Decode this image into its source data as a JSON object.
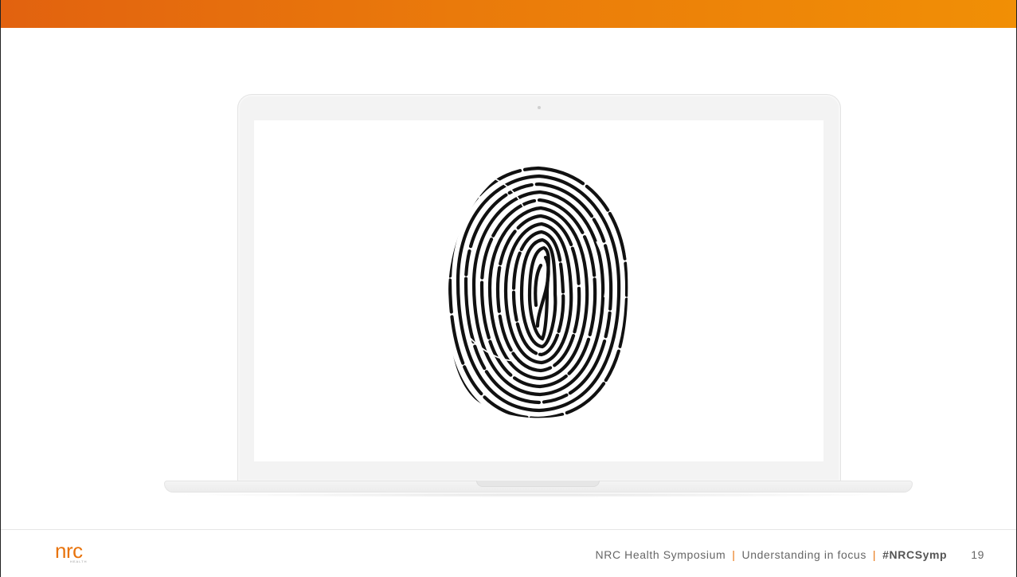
{
  "slide": {
    "accent_color": "#e8730c",
    "image": "laptop with fingerprint on screen"
  },
  "logo": {
    "mark": "nrc",
    "subtitle": "HEALTH"
  },
  "footer": {
    "event": "NRC Health Symposium",
    "separator": "|",
    "tagline": "Understanding in focus",
    "hashtag": "#NRCSymp",
    "page_number": "19"
  }
}
